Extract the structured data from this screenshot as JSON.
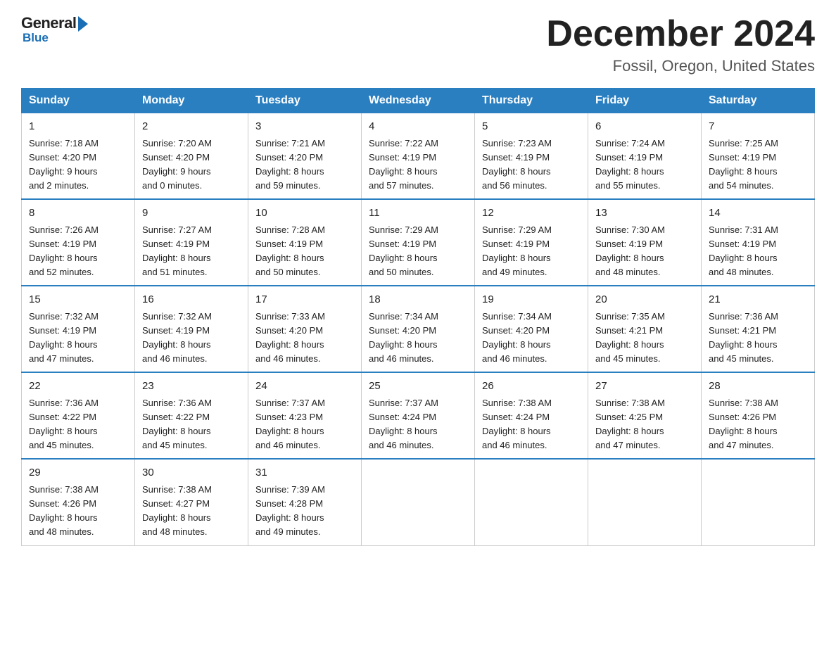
{
  "header": {
    "logo": {
      "general": "General",
      "blue": "Blue",
      "line2": "Blue"
    },
    "title": "December 2024",
    "location": "Fossil, Oregon, United States"
  },
  "calendar": {
    "days_of_week": [
      "Sunday",
      "Monday",
      "Tuesday",
      "Wednesday",
      "Thursday",
      "Friday",
      "Saturday"
    ],
    "weeks": [
      [
        {
          "day": "1",
          "sunrise": "7:18 AM",
          "sunset": "4:20 PM",
          "daylight": "9 hours and 2 minutes."
        },
        {
          "day": "2",
          "sunrise": "7:20 AM",
          "sunset": "4:20 PM",
          "daylight": "9 hours and 0 minutes."
        },
        {
          "day": "3",
          "sunrise": "7:21 AM",
          "sunset": "4:20 PM",
          "daylight": "8 hours and 59 minutes."
        },
        {
          "day": "4",
          "sunrise": "7:22 AM",
          "sunset": "4:19 PM",
          "daylight": "8 hours and 57 minutes."
        },
        {
          "day": "5",
          "sunrise": "7:23 AM",
          "sunset": "4:19 PM",
          "daylight": "8 hours and 56 minutes."
        },
        {
          "day": "6",
          "sunrise": "7:24 AM",
          "sunset": "4:19 PM",
          "daylight": "8 hours and 55 minutes."
        },
        {
          "day": "7",
          "sunrise": "7:25 AM",
          "sunset": "4:19 PM",
          "daylight": "8 hours and 54 minutes."
        }
      ],
      [
        {
          "day": "8",
          "sunrise": "7:26 AM",
          "sunset": "4:19 PM",
          "daylight": "8 hours and 52 minutes."
        },
        {
          "day": "9",
          "sunrise": "7:27 AM",
          "sunset": "4:19 PM",
          "daylight": "8 hours and 51 minutes."
        },
        {
          "day": "10",
          "sunrise": "7:28 AM",
          "sunset": "4:19 PM",
          "daylight": "8 hours and 50 minutes."
        },
        {
          "day": "11",
          "sunrise": "7:29 AM",
          "sunset": "4:19 PM",
          "daylight": "8 hours and 50 minutes."
        },
        {
          "day": "12",
          "sunrise": "7:29 AM",
          "sunset": "4:19 PM",
          "daylight": "8 hours and 49 minutes."
        },
        {
          "day": "13",
          "sunrise": "7:30 AM",
          "sunset": "4:19 PM",
          "daylight": "8 hours and 48 minutes."
        },
        {
          "day": "14",
          "sunrise": "7:31 AM",
          "sunset": "4:19 PM",
          "daylight": "8 hours and 48 minutes."
        }
      ],
      [
        {
          "day": "15",
          "sunrise": "7:32 AM",
          "sunset": "4:19 PM",
          "daylight": "8 hours and 47 minutes."
        },
        {
          "day": "16",
          "sunrise": "7:32 AM",
          "sunset": "4:19 PM",
          "daylight": "8 hours and 46 minutes."
        },
        {
          "day": "17",
          "sunrise": "7:33 AM",
          "sunset": "4:20 PM",
          "daylight": "8 hours and 46 minutes."
        },
        {
          "day": "18",
          "sunrise": "7:34 AM",
          "sunset": "4:20 PM",
          "daylight": "8 hours and 46 minutes."
        },
        {
          "day": "19",
          "sunrise": "7:34 AM",
          "sunset": "4:20 PM",
          "daylight": "8 hours and 46 minutes."
        },
        {
          "day": "20",
          "sunrise": "7:35 AM",
          "sunset": "4:21 PM",
          "daylight": "8 hours and 45 minutes."
        },
        {
          "day": "21",
          "sunrise": "7:36 AM",
          "sunset": "4:21 PM",
          "daylight": "8 hours and 45 minutes."
        }
      ],
      [
        {
          "day": "22",
          "sunrise": "7:36 AM",
          "sunset": "4:22 PM",
          "daylight": "8 hours and 45 minutes."
        },
        {
          "day": "23",
          "sunrise": "7:36 AM",
          "sunset": "4:22 PM",
          "daylight": "8 hours and 45 minutes."
        },
        {
          "day": "24",
          "sunrise": "7:37 AM",
          "sunset": "4:23 PM",
          "daylight": "8 hours and 46 minutes."
        },
        {
          "day": "25",
          "sunrise": "7:37 AM",
          "sunset": "4:24 PM",
          "daylight": "8 hours and 46 minutes."
        },
        {
          "day": "26",
          "sunrise": "7:38 AM",
          "sunset": "4:24 PM",
          "daylight": "8 hours and 46 minutes."
        },
        {
          "day": "27",
          "sunrise": "7:38 AM",
          "sunset": "4:25 PM",
          "daylight": "8 hours and 47 minutes."
        },
        {
          "day": "28",
          "sunrise": "7:38 AM",
          "sunset": "4:26 PM",
          "daylight": "8 hours and 47 minutes."
        }
      ],
      [
        {
          "day": "29",
          "sunrise": "7:38 AM",
          "sunset": "4:26 PM",
          "daylight": "8 hours and 48 minutes."
        },
        {
          "day": "30",
          "sunrise": "7:38 AM",
          "sunset": "4:27 PM",
          "daylight": "8 hours and 48 minutes."
        },
        {
          "day": "31",
          "sunrise": "7:39 AM",
          "sunset": "4:28 PM",
          "daylight": "8 hours and 49 minutes."
        },
        null,
        null,
        null,
        null
      ]
    ],
    "labels": {
      "sunrise": "Sunrise:",
      "sunset": "Sunset:",
      "daylight": "Daylight:"
    }
  }
}
